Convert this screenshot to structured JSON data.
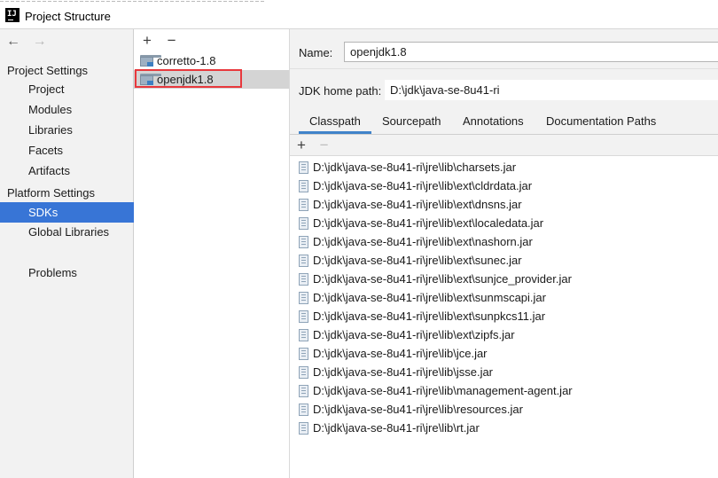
{
  "window": {
    "title": "Project Structure",
    "app_icon_text": "IJ"
  },
  "nav": {
    "back_icon": "←",
    "forward_icon": "→",
    "project_settings_header": "Project Settings",
    "project_settings": [
      "Project",
      "Modules",
      "Libraries",
      "Facets",
      "Artifacts"
    ],
    "platform_settings_header": "Platform Settings",
    "platform_settings": [
      "SDKs",
      "Global Libraries"
    ],
    "problems": "Problems",
    "selected": "SDKs"
  },
  "sdk_list": {
    "add_icon": "+",
    "remove_icon": "−",
    "items": [
      "corretto-1.8",
      "openjdk1.8"
    ],
    "selected": "openjdk1.8"
  },
  "detail": {
    "name_label": "Name:",
    "name_value": "openjdk1.8",
    "home_label": "JDK home path:",
    "home_value": "D:\\jdk\\java-se-8u41-ri",
    "tabs": [
      "Classpath",
      "Sourcepath",
      "Annotations",
      "Documentation Paths"
    ],
    "active_tab": "Classpath",
    "add_icon": "+",
    "remove_icon": "−",
    "classpath": [
      "D:\\jdk\\java-se-8u41-ri\\jre\\lib\\charsets.jar",
      "D:\\jdk\\java-se-8u41-ri\\jre\\lib\\ext\\cldrdata.jar",
      "D:\\jdk\\java-se-8u41-ri\\jre\\lib\\ext\\dnsns.jar",
      "D:\\jdk\\java-se-8u41-ri\\jre\\lib\\ext\\localedata.jar",
      "D:\\jdk\\java-se-8u41-ri\\jre\\lib\\ext\\nashorn.jar",
      "D:\\jdk\\java-se-8u41-ri\\jre\\lib\\ext\\sunec.jar",
      "D:\\jdk\\java-se-8u41-ri\\jre\\lib\\ext\\sunjce_provider.jar",
      "D:\\jdk\\java-se-8u41-ri\\jre\\lib\\ext\\sunmscapi.jar",
      "D:\\jdk\\java-se-8u41-ri\\jre\\lib\\ext\\sunpkcs11.jar",
      "D:\\jdk\\java-se-8u41-ri\\jre\\lib\\ext\\zipfs.jar",
      "D:\\jdk\\java-se-8u41-ri\\jre\\lib\\jce.jar",
      "D:\\jdk\\java-se-8u41-ri\\jre\\lib\\jsse.jar",
      "D:\\jdk\\java-se-8u41-ri\\jre\\lib\\management-agent.jar",
      "D:\\jdk\\java-se-8u41-ri\\jre\\lib\\resources.jar",
      "D:\\jdk\\java-se-8u41-ri\\jre\\lib\\rt.jar"
    ]
  },
  "colors": {
    "selection_blue": "#3875d6",
    "highlight_red": "#e8383d",
    "tab_underline": "#4083c9"
  }
}
